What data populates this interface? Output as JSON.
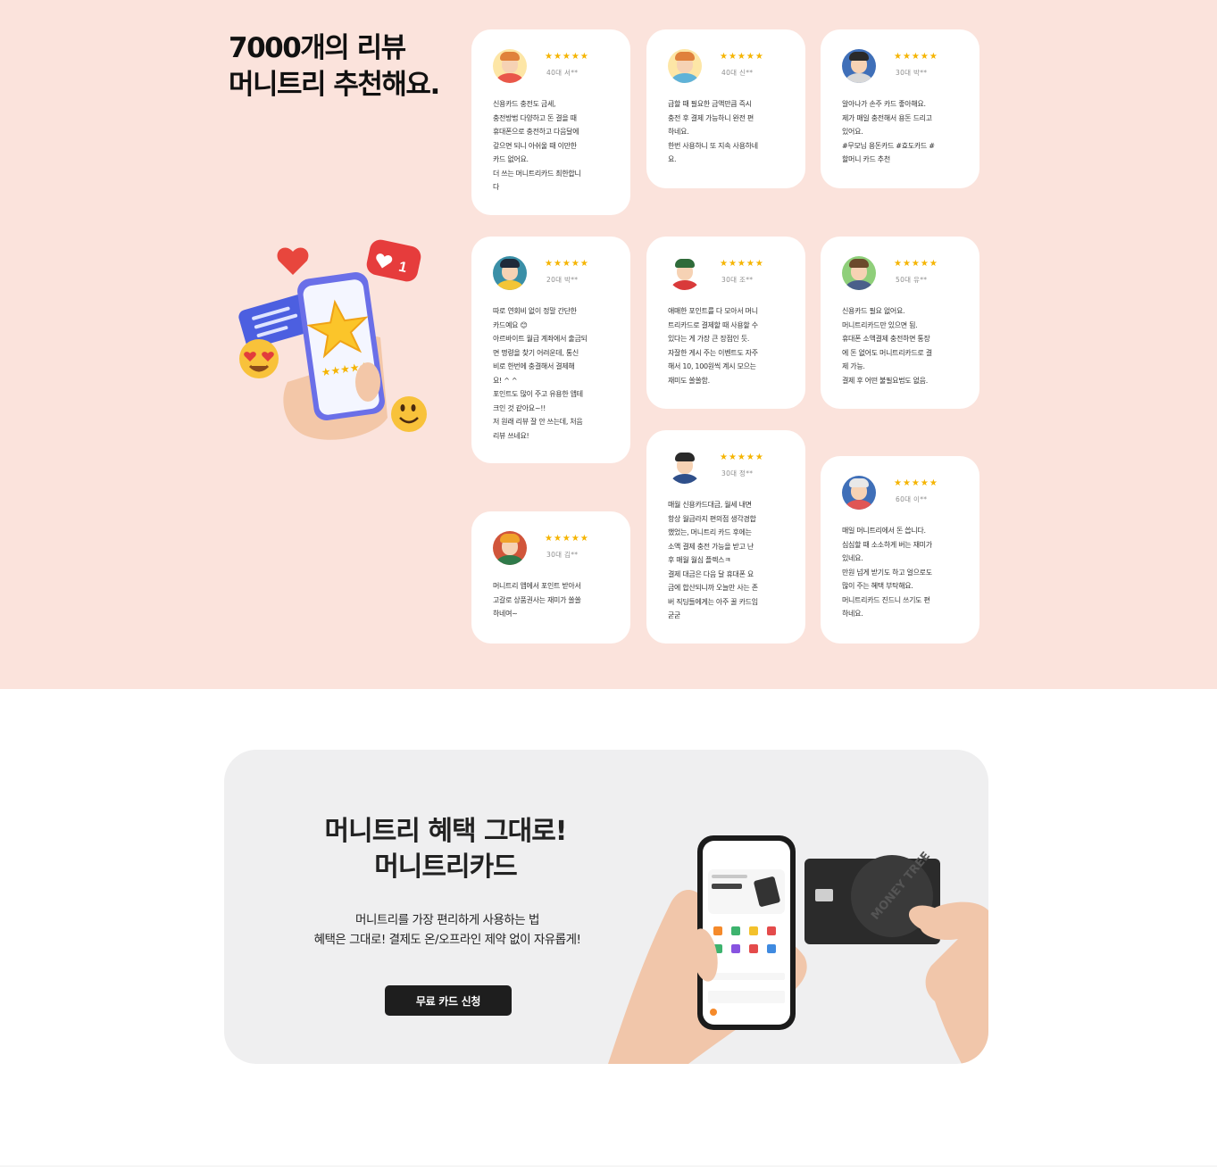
{
  "reviews_section": {
    "headline": [
      "7000개의 리뷰",
      "머니트리 추천해요."
    ],
    "cards": [
      {
        "stars": "★★★★★",
        "reviewer": "40대 서**",
        "avatar": {
          "bg": "#fde6a6",
          "hair": "#e0813c",
          "shirt": "#e9574a"
        },
        "text": "신용카드 충전도 금세,\n충전방법 다양하고 돈 결을 때\n휴대폰으로 충전하고 다음달에\n갚으면 되니 아쉬울 때 이만한\n카드 없어요.\n더 쓰는 머니트리카드 최한합니\n다"
      },
      {
        "stars": "★★★★★",
        "reviewer": "40대 신**",
        "avatar": {
          "bg": "#fde6a6",
          "hair": "#e0813c",
          "shirt": "#5fb2d8"
        },
        "text": "급할 때 필요한 금액만큼 즉시\n충전 후 결제 가능하니 완전 편\n하네요.\n한번 사용하니 또 지속 사용하네\n요."
      },
      {
        "stars": "★★★★★",
        "reviewer": "30대 박**",
        "avatar": {
          "bg": "#3f6fb8",
          "hair": "#2a2a2a",
          "shirt": "#d8d8d8"
        },
        "text": "알아나가 손주 카드 좋아해요.\n제가 매일 충전해서 용돈 드리고\n있어요.\n#무모님 용돈카드 #효도카드 #\n할머니 카드 추천"
      },
      {
        "stars": "★★★★★",
        "reviewer": "20대 박**",
        "avatar": {
          "bg": "#3a8fa7",
          "hair": "#1f2a3a",
          "shirt": "#f3c535"
        },
        "text": "따로 연회비 없이 정말 간단한\n카드예요 😊\n아르바이트 월급 계좌에서 출금되\n면 명령을 찾기 어려운데, 통신\n비로 한번에 충결해서 결제해\n요! ^ ^\n포인트도 많이 주고 유용한 앱테\n크인 것 같아요~!!\n저 원래 리뷰 잘 안 쓰는데, 처음\n리뷰 쓰네요!"
      },
      {
        "stars": "★★★★★",
        "reviewer": "30대 조**",
        "avatar": {
          "bg": "#ffffff",
          "hair": "#2f6b3a",
          "shirt": "#d93a3a"
        },
        "text": "애매한 포인트를 다 모아서 머니\n트리카드로 결제할 때 사용할 수\n있다는 게 가장 큰 장점인 듯.\n자잘한 게시 주는 이벤트도 자주\n해서 10, 100원씩 계시 모으는\n재미도 쏠쏠함."
      },
      {
        "stars": "★★★★★",
        "reviewer": "50대 유**",
        "avatar": {
          "bg": "#8fcf7a",
          "hair": "#6b4a2b",
          "shirt": "#4a5f8a"
        },
        "text": "신용카드 필요 없어요.\n머니트리카드만 있으면 됨.\n휴대폰 소액결제 충전하면 통장\n에 돈 없어도 머니트리카드로 결\n제 가능.\n결제 후 어떤 불필요법도 없음."
      },
      {
        "stars": "★★★★★",
        "reviewer": "30대 김**",
        "avatar": {
          "bg": "#d1553a",
          "hair": "#f0a22a",
          "shirt": "#2f7a4a"
        },
        "text": "머니트리 앱에서 포인트 받아서\n고갈로 상품권사는 재미가 쏠쏠\n하네여~"
      },
      {
        "stars": "★★★★★",
        "reviewer": "30대 정**",
        "avatar": {
          "bg": "#ffffff",
          "hair": "#2a2a2a",
          "shirt": "#2f4f8a"
        },
        "text": "매월 신용카드대금, 월세 내면\n항상 월급라지 편의점 생각경합\n했었는, 머니트리 카드 후에는\n소액 결제 충전 가능을 받고 난\n후 매월 월심 플렉스ㅋ\n결제 대금은 다음 달 휴대폰 요\n금에 합산되니까 오늘만 사는 존\n버 직딩들에게는 아주 꿀 카드임\n굳굳"
      },
      {
        "stars": "★★★★★",
        "reviewer": "60대 이**",
        "avatar": {
          "bg": "#3f6fb8",
          "hair": "#e8e8e8",
          "shirt": "#e05555"
        },
        "text": "매일 머니트리에서 돈 씁니다.\n심심할 때 소소하게 버는 재미가\n있네요.\n만원 넘게 받기도 하고 얼으로도\n많이 주는 혜택 부탁해요.\n머니트리카드 진드니 쓰기도 편\n하네요."
      }
    ]
  },
  "promo_section": {
    "title": [
      "머니트리 혜택 그대로!",
      "머니트리카드"
    ],
    "description": [
      "머니트리를 가장 편리하게 사용하는 법",
      "혜택은 그대로! 결제도 온/오프라인 제약 없이 자유롭게!"
    ],
    "button_label": "무료 카드 신청",
    "card_text": "MONEY TREE"
  },
  "colors": {
    "reviews_bg": "#fbe3dc",
    "star": "#f5b400",
    "button_bg": "#1e1e1e",
    "promo_bg": "#efeff0"
  }
}
